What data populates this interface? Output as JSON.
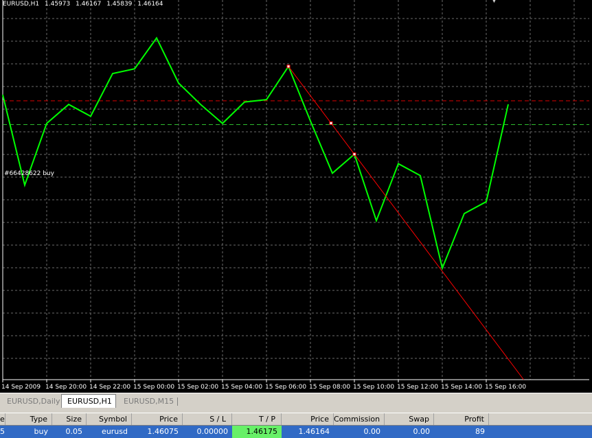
{
  "chart_header": {
    "symbol": "EURUSD,H1",
    "open": "1.45973",
    "high": "1.46167",
    "low": "1.45839",
    "close": "1.46164"
  },
  "order_label": "#66428622 buy",
  "colors": {
    "price_line": "#00ff00",
    "grid": "#6b6b6b",
    "tp_line": "#d80000",
    "order_line": "#2ebd2e",
    "trend_line": "#ff0000"
  },
  "chart_data": {
    "type": "line",
    "x": [
      "14 Sep 2009",
      "14 Sep 20:00",
      "14 Sep 22:00",
      "15 Sep 00:00",
      "15 Sep 02:00",
      "15 Sep 04:00",
      "15 Sep 06:00",
      "15 Sep 08:00",
      "15 Sep 10:00",
      "15 Sep 12:00",
      "15 Sep 14:00",
      "15 Sep 16:00"
    ],
    "series": [
      {
        "values": [
          1.462,
          1.4582,
          1.4608,
          1.4616,
          1.4611,
          1.4629,
          1.4631,
          1.4644,
          1.4625,
          1.4616,
          1.4608,
          1.4617,
          1.4618,
          1.4632,
          1.4609,
          1.4587,
          1.4595,
          1.4567,
          1.4591,
          1.4586,
          1.4547,
          1.457,
          1.4575,
          1.4616
        ]
      }
    ],
    "ylim": [
      1.45,
      1.466
    ],
    "grid": true
  },
  "tabs": [
    {
      "label": "EURUSD,Daily",
      "active": false
    },
    {
      "label": "EURUSD,H1",
      "active": true
    },
    {
      "label": "EURUSD,M15",
      "active": false
    }
  ],
  "trade_table": {
    "headers": [
      "e",
      "Type",
      "Size",
      "Symbol",
      "Price",
      "S / L",
      "T / P",
      "Price",
      "Commission",
      "Swap",
      "Profit"
    ],
    "row": [
      "5",
      "buy",
      "0.05",
      "eurusd",
      "1.46075",
      "0.00000",
      "1.46175",
      "1.46164",
      "0.00",
      "0.00",
      "89"
    ]
  }
}
